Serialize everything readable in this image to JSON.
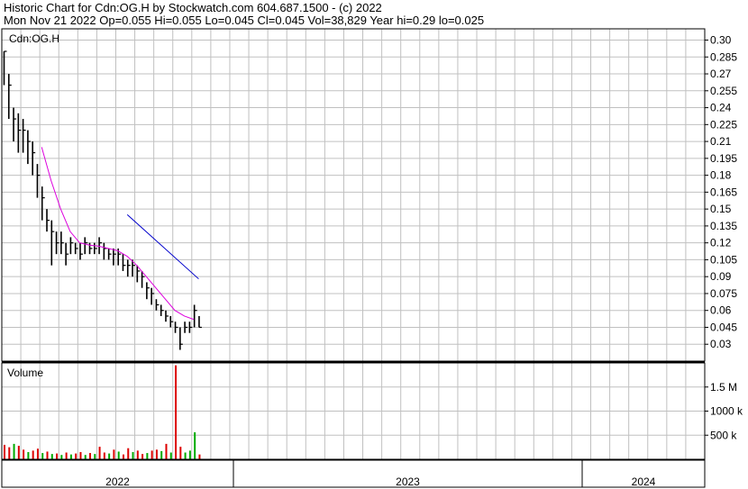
{
  "header": {
    "line1": "Historic Chart for Cdn:OG.H by Stockwatch.com 604.687.1500 - (c) 2022",
    "line2": "Mon Nov 21 2022   Op=0.055   Hi=0.055   Lo=0.045   Cl=0.045   Vol=38,829   Year hi=0.29   lo=0.025"
  },
  "colors": {
    "up_volume": "#00aa00",
    "down_volume": "#dd0000",
    "spike_volume": "#dd0000",
    "ma_short": "#dd00dd",
    "ma_long": "#0000cc",
    "price_bars": "#000000",
    "grid": "#c0c0c0"
  },
  "chart_data": [
    {
      "type": "line",
      "title": "Cdn:OG.H",
      "x_unit": "weeks from chart start",
      "xlim": [
        0,
        147
      ],
      "ylim": [
        0.015,
        0.31
      ],
      "y_ticks": [
        "0.30",
        "0.285",
        "0.27",
        "0.255",
        "0.24",
        "0.225",
        "0.21",
        "0.195",
        "0.18",
        "0.165",
        "0.15",
        "0.135",
        "0.12",
        "0.105",
        "0.09",
        "0.075",
        "0.06",
        "0.045",
        "0.03"
      ],
      "grid": true,
      "series": [
        {
          "name": "",
          "kind": "ohlc",
          "x": [
            0,
            1,
            2,
            3,
            4,
            5,
            6,
            7,
            8,
            9,
            10,
            11,
            12,
            13,
            14,
            15,
            16,
            17,
            18,
            19,
            20,
            21,
            22,
            23,
            24,
            25,
            26,
            27,
            28,
            29,
            30,
            31,
            32,
            33,
            34,
            35,
            36,
            37,
            38,
            39,
            40,
            41
          ],
          "close": [
            0.29,
            0.26,
            0.23,
            0.22,
            0.22,
            0.21,
            0.2,
            0.18,
            0.16,
            0.14,
            0.13,
            0.12,
            0.12,
            0.11,
            0.12,
            0.115,
            0.11,
            0.12,
            0.115,
            0.115,
            0.12,
            0.115,
            0.11,
            0.11,
            0.11,
            0.1,
            0.1,
            0.1,
            0.095,
            0.09,
            0.08,
            0.075,
            0.065,
            0.06,
            0.055,
            0.05,
            0.045,
            0.03,
            0.045,
            0.045,
            0.06,
            0.045
          ],
          "high": [
            0.29,
            0.27,
            0.24,
            0.235,
            0.23,
            0.22,
            0.21,
            0.19,
            0.17,
            0.15,
            0.14,
            0.13,
            0.13,
            0.12,
            0.125,
            0.12,
            0.12,
            0.125,
            0.12,
            0.12,
            0.125,
            0.12,
            0.115,
            0.115,
            0.115,
            0.11,
            0.105,
            0.105,
            0.1,
            0.095,
            0.085,
            0.08,
            0.07,
            0.065,
            0.06,
            0.055,
            0.05,
            0.045,
            0.05,
            0.05,
            0.065,
            0.055
          ],
          "low": [
            0.26,
            0.23,
            0.21,
            0.2,
            0.2,
            0.19,
            0.18,
            0.16,
            0.14,
            0.13,
            0.1,
            0.11,
            0.11,
            0.1,
            0.11,
            0.11,
            0.105,
            0.11,
            0.11,
            0.11,
            0.11,
            0.105,
            0.105,
            0.1,
            0.1,
            0.095,
            0.09,
            0.09,
            0.085,
            0.08,
            0.07,
            0.065,
            0.06,
            0.055,
            0.05,
            0.045,
            0.04,
            0.025,
            0.04,
            0.04,
            0.045,
            0.045
          ]
        },
        {
          "name": "",
          "kind": "moving-average-short",
          "x": [
            8,
            10,
            12,
            14,
            16,
            18,
            20,
            22,
            24,
            26,
            28,
            30,
            32,
            34,
            36,
            38,
            40
          ],
          "y": [
            0.205,
            0.175,
            0.15,
            0.13,
            0.12,
            0.118,
            0.117,
            0.115,
            0.113,
            0.108,
            0.1,
            0.09,
            0.08,
            0.07,
            0.06,
            0.055,
            0.052
          ]
        },
        {
          "name": "",
          "kind": "moving-average-long",
          "x": [
            26,
            41
          ],
          "y": [
            0.145,
            0.088
          ]
        }
      ]
    },
    {
      "type": "bar",
      "title": "Volume",
      "ylim": [
        0,
        2000000
      ],
      "y_ticks": [
        "1.5 M",
        "1000 k",
        "500 k"
      ],
      "grid": true,
      "x": [
        0,
        1,
        2,
        3,
        4,
        5,
        6,
        7,
        8,
        9,
        10,
        11,
        12,
        13,
        14,
        15,
        16,
        17,
        18,
        19,
        20,
        21,
        22,
        23,
        24,
        25,
        26,
        27,
        28,
        29,
        30,
        31,
        32,
        33,
        34,
        35,
        36,
        37,
        38,
        39,
        40,
        41
      ],
      "values": [
        300000,
        250000,
        320000,
        280000,
        200000,
        150000,
        180000,
        220000,
        130000,
        160000,
        110000,
        120000,
        90000,
        140000,
        100000,
        120000,
        150000,
        90000,
        130000,
        110000,
        260000,
        140000,
        120000,
        200000,
        160000,
        100000,
        230000,
        150000,
        180000,
        110000,
        130000,
        180000,
        200000,
        170000,
        320000,
        140000,
        1950000,
        260000,
        140000,
        180000,
        560000,
        100000
      ],
      "directions": [
        "down",
        "down",
        "up",
        "down",
        "down",
        "up",
        "down",
        "down",
        "up",
        "down",
        "up",
        "down",
        "up",
        "down",
        "up",
        "down",
        "down",
        "up",
        "down",
        "up",
        "down",
        "down",
        "up",
        "down",
        "up",
        "down",
        "down",
        "up",
        "down",
        "down",
        "up",
        "down",
        "down",
        "up",
        "down",
        "up",
        "down",
        "down",
        "up",
        "up",
        "up",
        "down"
      ]
    }
  ],
  "time_axis": {
    "labels": [
      "2022",
      "2023",
      "2024"
    ]
  }
}
